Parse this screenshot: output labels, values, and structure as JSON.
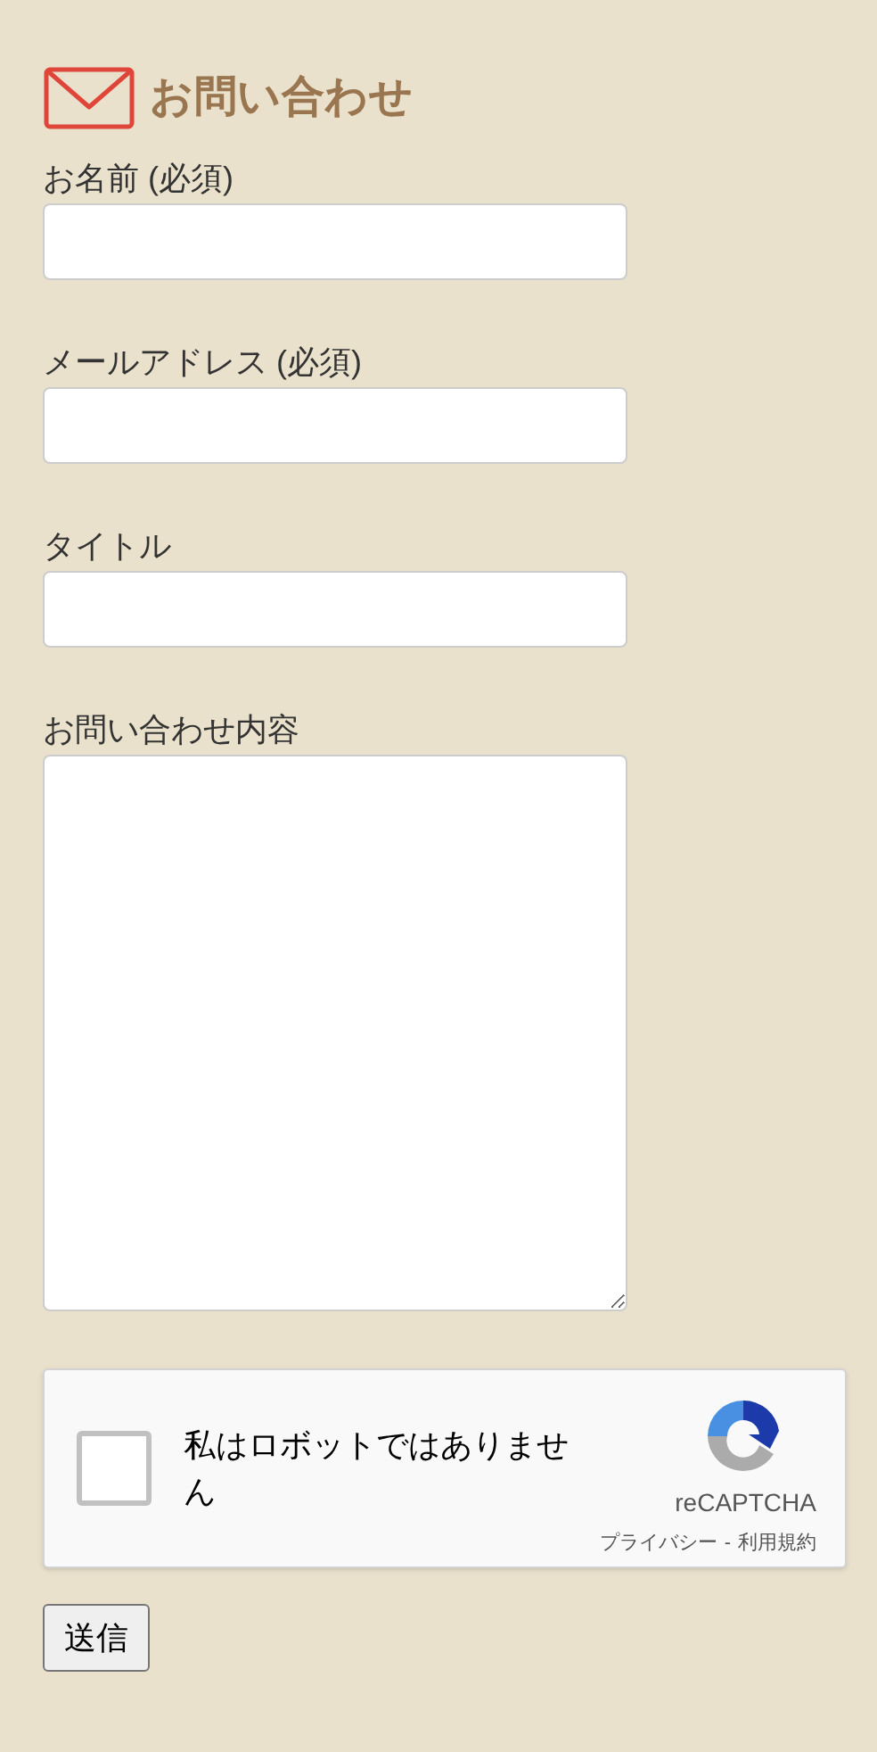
{
  "heading": "お問い合わせ",
  "fields": [
    {
      "label": "お名前 (必須)",
      "kind": "text"
    },
    {
      "label": "メールアドレス (必須)",
      "kind": "text"
    },
    {
      "label": "タイトル",
      "kind": "text"
    },
    {
      "label": "お問い合わせ内容",
      "kind": "textarea"
    }
  ],
  "recaptcha": {
    "label": "私はロボットではありません",
    "checked": false,
    "brand": "reCAPTCHA",
    "links": [
      "プライバシー",
      "利用規約"
    ],
    "separator": "-"
  },
  "submit": "送信"
}
